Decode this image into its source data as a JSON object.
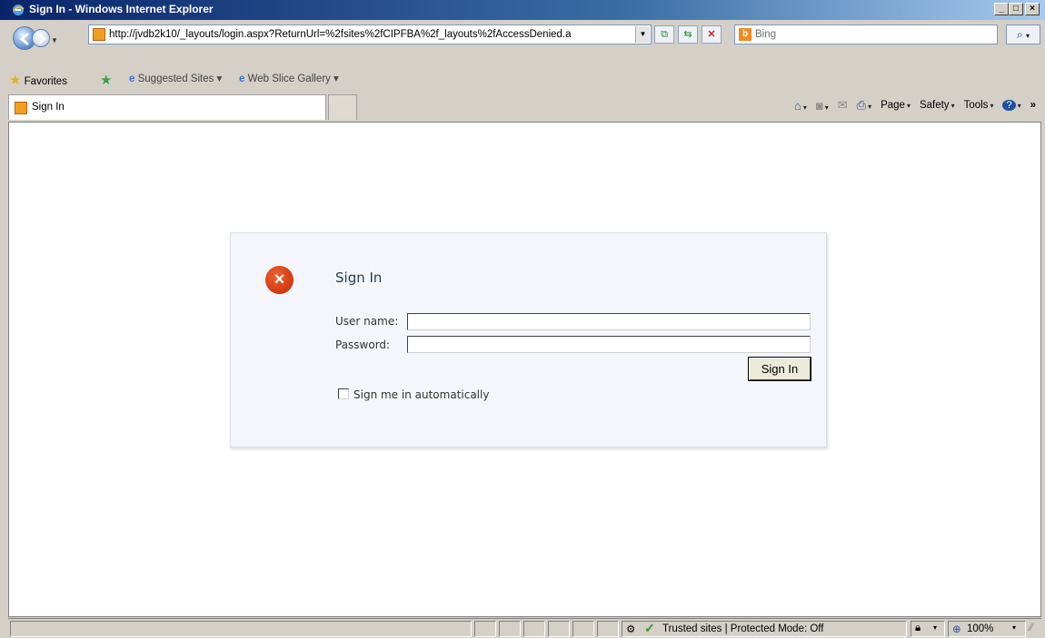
{
  "window": {
    "title": "Sign In - Windows Internet Explorer",
    "minimize": "_",
    "maximize": "□",
    "close": "×"
  },
  "address": {
    "url": "http://jvdb2k10/_layouts/login.aspx?ReturnUrl=%2fsites%2fCIPFBA%2f_layouts%2fAccessDenied.a",
    "search_placeholder": "Bing"
  },
  "favorites": {
    "label": "Favorites",
    "items": [
      {
        "label": "Suggested Sites ▾"
      },
      {
        "label": "Web Slice Gallery ▾"
      }
    ]
  },
  "tabs": [
    {
      "label": "Sign In"
    }
  ],
  "command_bar": {
    "page": "Page",
    "safety": "Safety",
    "tools": "Tools",
    "more": "»"
  },
  "signin": {
    "title": "Sign In",
    "username_label": "User name:",
    "password_label": "Password:",
    "button_label": "Sign In",
    "remember_label": "Sign me in automatically"
  },
  "status": {
    "zone": "Trusted sites | Protected Mode: Off",
    "zoom": "100%"
  },
  "colors": {
    "error_icon": "#d03a10",
    "title_bar": "#0a246a"
  }
}
